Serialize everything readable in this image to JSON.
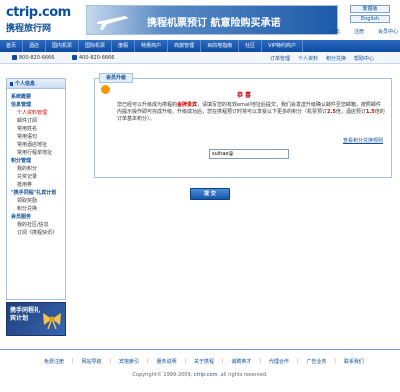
{
  "header": {
    "logo_text": "ctrip.com",
    "logo_sub": "携程旅行网",
    "banner_text": "携程机票预订 航意险购买承诺",
    "lang_1": "繁體版",
    "lang_2": "English",
    "top_links": [
      "退出",
      "注册",
      "会员中心"
    ]
  },
  "nav": {
    "items": [
      "首页",
      "酒店",
      "国内机票",
      "国际机票",
      "度假",
      "特惠商户",
      "商旅管理",
      "目的地指南",
      "社区",
      "VIP特约商户"
    ]
  },
  "subbar": {
    "phone_1": "800-820-6666",
    "phone_2": "400-820-6666",
    "quick_links": [
      "订单管理",
      "个人资料",
      "积分兑换",
      "帮助中心"
    ]
  },
  "sidebar": {
    "title": "个人信息",
    "items": [
      {
        "label": "系统概要",
        "type": "group"
      },
      {
        "label": "信息管理",
        "type": "group"
      },
      {
        "label": "个人资料管理",
        "type": "item",
        "current": true
      },
      {
        "label": "邮件订阅",
        "type": "item"
      },
      {
        "label": "常用姓名",
        "type": "item"
      },
      {
        "label": "常用语句",
        "type": "item"
      },
      {
        "label": "常用酒店地址",
        "type": "item"
      },
      {
        "label": "常用行程单地址",
        "type": "item"
      },
      {
        "label": "积分管理",
        "type": "group"
      },
      {
        "label": "我的积分",
        "type": "item"
      },
      {
        "label": "兑奖记录",
        "type": "item"
      },
      {
        "label": "抵用券",
        "type": "item"
      },
      {
        "label": "\"携手同程\"礼宾计划",
        "type": "group"
      },
      {
        "label": "领取奖励",
        "type": "item"
      },
      {
        "label": "积分兑换",
        "type": "item"
      },
      {
        "label": "会员服务",
        "type": "group"
      },
      {
        "label": "我的社区/信息",
        "type": "item"
      },
      {
        "label": "订阅《携程快讯》",
        "type": "item"
      }
    ],
    "ad_text": "携手同程礼宾计划"
  },
  "panel": {
    "tab_title": "会员升级",
    "congrats": "恭 喜",
    "message_1": "您已经可以升级成为携程的",
    "message_highlight": "金牌贵宾",
    "message_2": "，请填写您的有效email地址后提交，我们会发送升级确认邮件至您邮箱，按照邮件内提示操作即可完成升级。升级成功后，您在携程预订时将可以享受以下更多的积分（机票预订",
    "message_hl2": "2.5",
    "message_3": "倍，酒店预订",
    "message_hl3": "1.5",
    "message_4": "倍的订单基本积分）。",
    "view_link": "查看积分兑换规则",
    "email_value": "suihao@",
    "submit_label": "提 交"
  },
  "footer": {
    "links": [
      "免费注册",
      "网站导航",
      "宾馆索引",
      "服务说明",
      "关于携程",
      "诚聘英才",
      "代理合作",
      "广告业务",
      "联系我们"
    ],
    "copyright_1": "Copyright© 1999-2009,",
    "copyright_link": "ctrip.com",
    "copyright_2": ". all rights reserved."
  },
  "colors": {
    "brand": "#0e4b9f",
    "accent": "#d40000",
    "highlight": "#f39800"
  }
}
